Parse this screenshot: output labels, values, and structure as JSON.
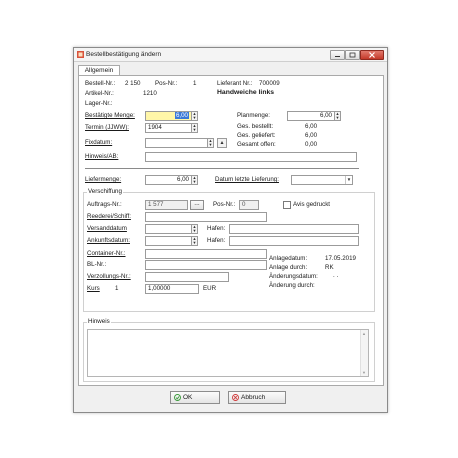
{
  "window": {
    "title": "Bestellbestätigung ändern"
  },
  "tab": {
    "label": "Allgemein"
  },
  "info": {
    "bestell_label": "Bestell-Nr.:",
    "bestell_value": "2 150",
    "pos_label": "Pos-Nr.:",
    "pos_value": "1",
    "lieferant_label": "Lieferant Nr.:",
    "lieferant_value": "700009",
    "artikel_label": "Artikel-Nr.:",
    "artikel_value": "1210",
    "artikel_name": "Handweiche links",
    "lager_label": "Lager-Nr.:"
  },
  "form": {
    "bestaetigte_menge_label": "Bestätigte Menge:",
    "bestaetigte_menge_value": "6,00",
    "termin_label": "Termin (JJWW):",
    "termin_value": "1904",
    "fixdatum_label": "Fixdatum:",
    "hinweis_ab_label": "Hinweis/AB:",
    "planmenge_label": "Planmenge:",
    "planmenge_value": "6,00",
    "ges_bestellt_label": "Ges. bestellt:",
    "ges_bestellt_value": "6,00",
    "ges_geliefert_label": "Ges. geliefert:",
    "ges_geliefert_value": "6,00",
    "gesamt_offen_label": "Gesamt offen:",
    "gesamt_offen_value": "0,00",
    "liefermenge_label": "Liefermenge:",
    "liefermenge_value": "6,00",
    "datum_letzte_label": "Datum letzte Lieferung:"
  },
  "verschiffung": {
    "group_label": "Verschiffung",
    "auftrags_label": "Auftrags-Nr.:",
    "auftrags_value": "1 577",
    "ellipsis": "...",
    "posnr_label": "Pos-Nr.:",
    "posnr_value": "0",
    "avis_label": "Avis gedruckt",
    "reederei_label": "Reederei/Schiff:",
    "versanddatum_label": "Versanddatum",
    "ankunftsdatum_label": "Ankunftsdatum:",
    "hafen1_label": "Hafen:",
    "hafen2_label": "Hafen:",
    "container_label": "Container-Nr.:",
    "bl_label": "BL-Nr.:",
    "verzollungs_label": "Verzollungs-Nr.:",
    "kurs_label": "Kurs",
    "kurs_index": "1",
    "kurs_value": "1,00000",
    "currency": "EUR",
    "anlagedatum_label": "Anlagedatum:",
    "anlagedatum_value": "17.05.2019",
    "anlage_durch_label": "Anlage durch:",
    "anlage_durch_value": "RK",
    "aenderungsdatum_label": "Änderungsdatum:",
    "aenderungsdatum_value": ". .",
    "aenderung_durch_label": "Änderung durch:"
  },
  "hinweis": {
    "group_label": "Hinweis"
  },
  "buttons": {
    "ok": "OK",
    "abbruch": "Abbruch"
  },
  "colors": {
    "highlight": "#fff6a8",
    "ok_icon": "#3a9a3a",
    "cancel_icon": "#d03a3a"
  }
}
